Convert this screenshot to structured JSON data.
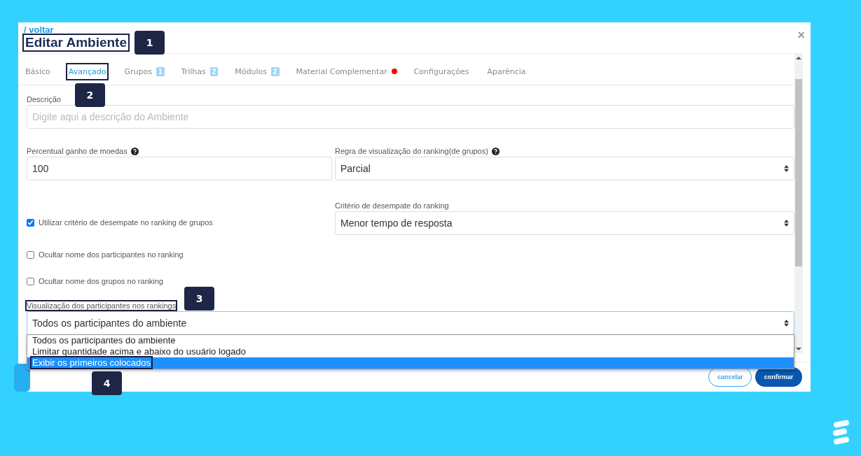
{
  "header": {
    "back_link": "/ voltar",
    "close": "×",
    "title": {
      "text": "Editar Ambiente",
      "annotated": true,
      "callout": "1"
    }
  },
  "tabs": [
    {
      "label": "Básico",
      "selected": false
    },
    {
      "label": "Avançado",
      "selected": true,
      "annotated": true,
      "callout": "2"
    },
    {
      "label": "Grupos",
      "selected": false,
      "badge": "1"
    },
    {
      "label": "Trilhas",
      "selected": false,
      "badge": "2"
    },
    {
      "label": "Módulos",
      "selected": false,
      "badge": "2"
    },
    {
      "label": "Material Complementar",
      "selected": false,
      "color": "#ff0000"
    },
    {
      "label": "Configurações",
      "selected": false
    },
    {
      "label": "Aparência",
      "selected": false
    }
  ],
  "description": {
    "label": "Descrição",
    "placeholder": "Digite aqui a descrição do Ambiente"
  },
  "coins": {
    "label": "Percentual ganho de moedas",
    "help": true,
    "value": "100"
  },
  "ranking_rule": {
    "label": "Regra de visualização do ranking(de grupos)",
    "help": true,
    "value": "Parcial"
  },
  "tiebreak_checkbox": {
    "label": "Utilizar critério de desempate no ranking de grupos",
    "checked": true
  },
  "tiebreak_criterion": {
    "label": "Critério de desempate do ranking",
    "value": "Menor tempo de resposta"
  },
  "checkboxes": [
    {
      "label": "Ocultar nome dos participantes no ranking",
      "checked": false
    },
    {
      "label": "Ocultar nome dos grupos no ranking",
      "checked": false
    }
  ],
  "participants_view": {
    "label": "Visualização dos participantes nos rankings",
    "annotated": true,
    "callout": "3",
    "value": "Todos os participantes do ambiente",
    "options": [
      {
        "label": "Todos os participantes do ambiente",
        "highlighted": false
      },
      {
        "label": "Limitar quantidade acima e abaixo do usuário logado",
        "highlighted": false
      },
      {
        "label": "Exibir os primeiros colocados",
        "highlighted": true,
        "annotated": true,
        "callout": "4"
      }
    ]
  },
  "buttons": [
    {
      "label": "cancelar",
      "kind": "outline"
    },
    {
      "label": "confirmar",
      "kind": "primary"
    }
  ]
}
